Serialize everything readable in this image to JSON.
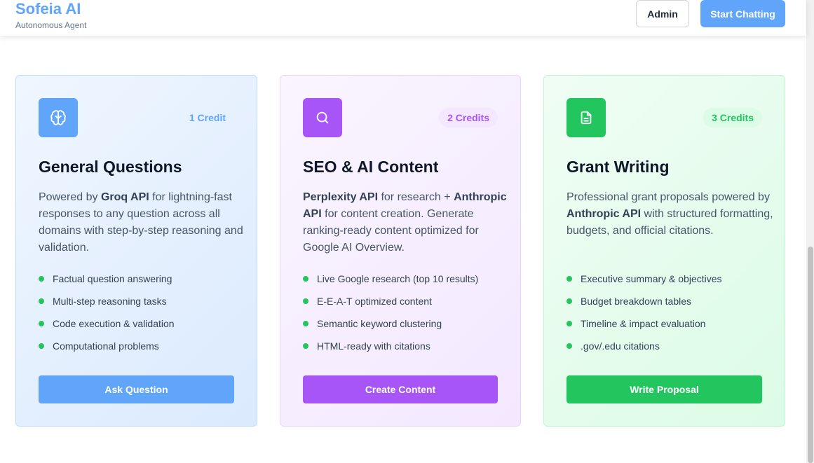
{
  "header": {
    "brand_title": "Sofeia AI",
    "brand_subtitle": "Autonomous Agent",
    "admin_label": "Admin",
    "start_label": "Start Chatting"
  },
  "cards": [
    {
      "icon": "brain-icon",
      "badge": "1 Credit",
      "title": "General Questions",
      "desc": {
        "p1": "Powered by ",
        "b1": "Groq API",
        "p2": " for lightning-fast responses to any question across all domains with step-by-step reasoning and validation."
      },
      "features": [
        "Factual question answering",
        "Multi-step reasoning tasks",
        "Code execution & validation",
        "Computational problems"
      ],
      "button": "Ask Question",
      "accent": "#60a5fa"
    },
    {
      "icon": "search-icon",
      "badge": "2 Credits",
      "title": "SEO & AI Content",
      "desc": {
        "b1": "Perplexity API",
        "p1": " for research + ",
        "b2": "Anthropic API",
        "p2": " for content creation. Generate ranking-ready content optimized for Google AI Overview."
      },
      "features": [
        "Live Google research (top 10 results)",
        "E-E-A-T optimized content",
        "Semantic keyword clustering",
        "HTML-ready with citations"
      ],
      "button": "Create Content",
      "accent": "#a855f7"
    },
    {
      "icon": "document-icon",
      "badge": "3 Credits",
      "title": "Grant Writing",
      "desc": {
        "p1": "Professional grant proposals powered by ",
        "b1": "Anthropic API",
        "p2": " with structured formatting, budgets, and official citations."
      },
      "features": [
        "Executive summary & objectives",
        "Budget breakdown tables",
        "Timeline & impact evaluation",
        ".gov/.edu citations"
      ],
      "button": "Write Proposal",
      "accent": "#22c55e"
    }
  ],
  "colors": {
    "feature_dot": "#22c55e",
    "brand": "#60a5fa"
  }
}
